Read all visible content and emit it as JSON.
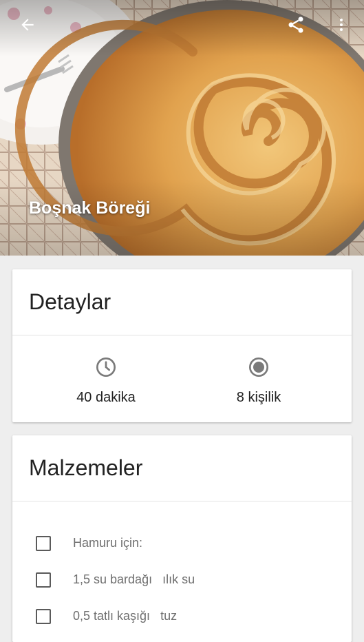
{
  "recipe": {
    "title": "Boşnak Böreği"
  },
  "toolbar": {
    "back_icon": "arrow-left-icon",
    "share_icon": "share-icon",
    "more_icon": "more-vert-icon"
  },
  "details": {
    "header": "Detaylar",
    "time": {
      "icon": "clock-icon",
      "label": "40 dakika"
    },
    "servings": {
      "icon": "servings-icon",
      "label": "8 kişilik"
    }
  },
  "ingredients": {
    "header": "Malzemeler",
    "items": [
      {
        "text": "Hamuru için:"
      },
      {
        "text": "1,5 su bardağı   ılık su"
      },
      {
        "text": "0,5 tatlı kaşığı   tuz"
      }
    ]
  },
  "colors": {
    "background": "#eeeeee",
    "card": "#ffffff",
    "header_text": "#222222",
    "icon_gray": "#7a7a7a"
  }
}
